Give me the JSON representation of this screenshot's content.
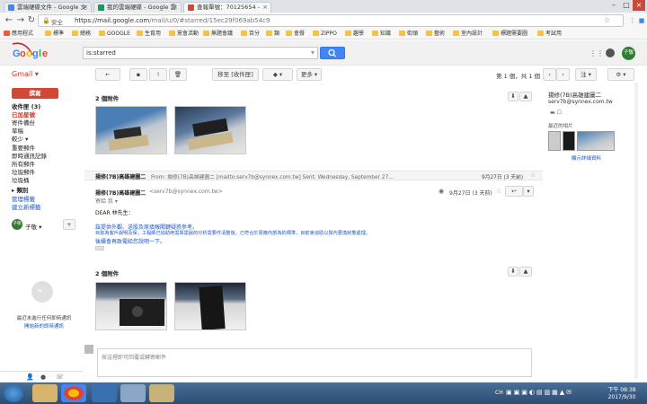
{
  "browser": {
    "tabs": [
      {
        "title": "雲端硬碟文件 - Google 文",
        "color": "#4285f4"
      },
      {
        "title": "我的雲端硬碟 - Google 雲",
        "color": "#0f9d58"
      },
      {
        "title": "查報單號：70125654 -",
        "color": "#db4437"
      }
    ],
    "secure_label": "安全",
    "url_host": "https://mail.google.com",
    "url_path": "/mail/u/0/#starred/15ec29f069ab54c9",
    "bookmarks": [
      "應用程式",
      "標準",
      "總務",
      "GOOGLE",
      "生育用",
      "黨會活動",
      "無題會議",
      "百分",
      "類",
      "會餐",
      "ZIPPO",
      "趣學",
      "知識",
      "街頭",
      "藝術",
      "室內設計",
      "標題需要圖",
      "考試用"
    ]
  },
  "gmail": {
    "logo_text": "Gmail",
    "search_query": "is:starred",
    "avatar_text": "子敬",
    "toolbar": {
      "move_label": "移至 [收件匣]",
      "more_label": "更多",
      "pager": "第 1 個，共 1 個",
      "lang": "注"
    },
    "compose_label": "撰寫",
    "nav": [
      {
        "label": "收件匣 (3)",
        "active": false,
        "bold": true
      },
      {
        "label": "已加星號",
        "active": true,
        "bold": false
      },
      {
        "label": "寄件備份",
        "active": false,
        "bold": false
      },
      {
        "label": "草稿",
        "active": false,
        "bold": false
      },
      {
        "label": "較少 ▾",
        "active": false,
        "bold": false
      },
      {
        "label": "重要郵件",
        "active": false,
        "bold": false
      },
      {
        "label": "即時通訊記錄",
        "active": false,
        "bold": false
      },
      {
        "label": "所有郵件",
        "active": false,
        "bold": false
      },
      {
        "label": "垃圾郵件",
        "active": false,
        "bold": false
      },
      {
        "label": "垃圾桶",
        "active": false,
        "bold": false
      },
      {
        "label": "▸ 類別",
        "active": false,
        "bold": true
      },
      {
        "label": "管理標籤",
        "active": false,
        "bold": false,
        "link": true
      },
      {
        "label": "建立新標籤",
        "active": false,
        "bold": false,
        "link": true
      }
    ],
    "chat_user": "子敬 ▾",
    "hangouts_empty": "最近未進行任何即時通訊",
    "hangouts_link": "開始新的即時通訊",
    "attachments_1": "2 個附件",
    "attachments_2": "2 個附件",
    "collapsed_msg": {
      "sender": "揚修(7B)高雄建圖二",
      "snippet": "From: 揚修(7B)高雄建圖二 [mailto:serv7b@synnex.com.tw] Sent: Wednesday, September 27...",
      "date": "9月27日 (3 天前)"
    },
    "open_msg": {
      "sender": "揚修(7B)高雄建圖二",
      "email": "<serv7b@synnex.com.tw>",
      "to": "寄給 我 ▾",
      "date": "9月27日 (3 天前)",
      "greeting": "DEAR 林先生：",
      "body": [
        "茲提供外觀、送股及原填報關鍵疑惑參考。",
        "目前為客戶說明及保，工程師已協助用需與需說的分析需要件清整後，已符合於原廠內部為的標準，目前會協助以與內更換狀態處理。",
        "後續會再致電給您說明一下。"
      ]
    },
    "reply_placeholder": "按這裡即可回覆或轉寄郵件",
    "contact": {
      "name": "揚修(7B)高雄建圖二",
      "email": "serv7b@synnex.com.tw",
      "photos_label": "最近的相片",
      "more_link": "顯示詳細資料"
    },
    "taskbar": {
      "lang": "CH",
      "time": "下午 08:38",
      "date": "2017/9/30"
    }
  }
}
